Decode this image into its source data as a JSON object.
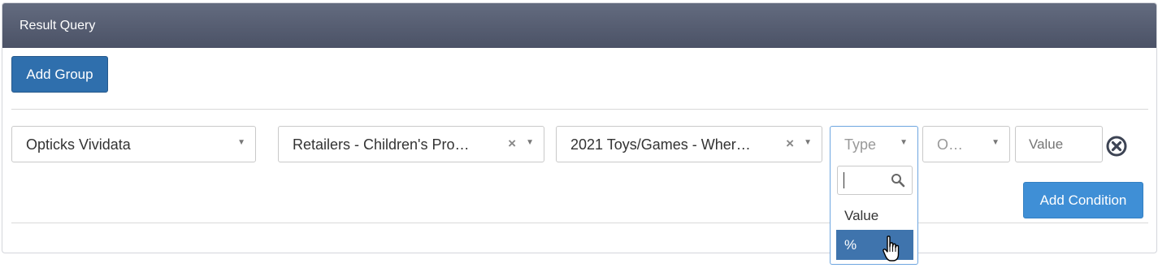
{
  "panel": {
    "title": "Result Query"
  },
  "buttons": {
    "add_group": "Add Group",
    "add_condition": "Add Condition"
  },
  "condition": {
    "source": "Opticks Vividata",
    "category": "Retailers - Children's Pro…",
    "question": "2021 Toys/Games - Wher…",
    "type_placeholder": "Type",
    "operator_placeholder": "O…",
    "value_placeholder": "Value"
  },
  "type_dropdown": {
    "search_value": "",
    "options": [
      "Value",
      "%"
    ],
    "highlighted": "%"
  },
  "colors": {
    "header": "#565d72",
    "primary_button": "#2f6fad",
    "accent_button": "#3f8fd6",
    "highlight": "#3f74ad"
  }
}
